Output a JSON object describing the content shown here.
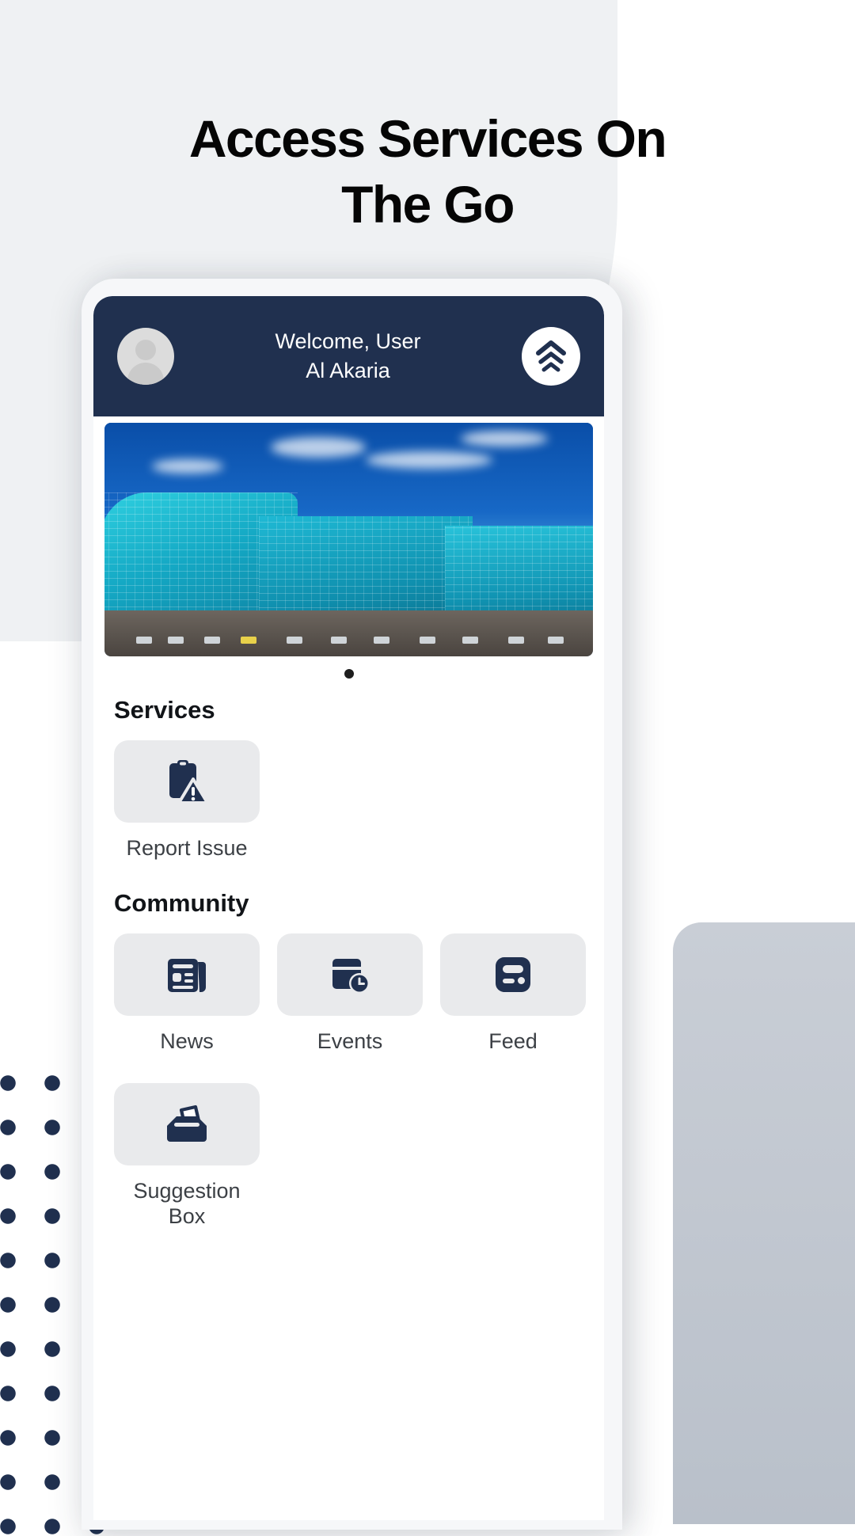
{
  "headline": {
    "line1": "Access Services On",
    "line2": "The Go"
  },
  "app": {
    "header": {
      "welcome_line1": "Welcome, User",
      "welcome_line2": "Al Akaria",
      "avatar_name": "user-avatar",
      "logo_name": "al-akaria-logo",
      "bg_color": "#20304f"
    },
    "carousel": {
      "dot_count": 1,
      "active_index": 0,
      "image_alt": "Al Akaria glass office building"
    },
    "sections": [
      {
        "title": "Services",
        "items": [
          {
            "label": "Report Issue",
            "icon": "clipboard-warning-icon"
          }
        ]
      },
      {
        "title": "Community",
        "items": [
          {
            "label": "News",
            "icon": "newspaper-icon"
          },
          {
            "label": "Events",
            "icon": "calendar-clock-icon"
          },
          {
            "label": "Feed",
            "icon": "feed-list-icon"
          },
          {
            "label": "Suggestion Box",
            "icon": "suggestion-box-icon"
          }
        ]
      }
    ]
  },
  "colors": {
    "navy": "#20304f",
    "tile_bg": "#e9eaec",
    "page_bg": "#ffffff",
    "blob_grey": "#eff1f3",
    "label_text": "#3c4045"
  }
}
